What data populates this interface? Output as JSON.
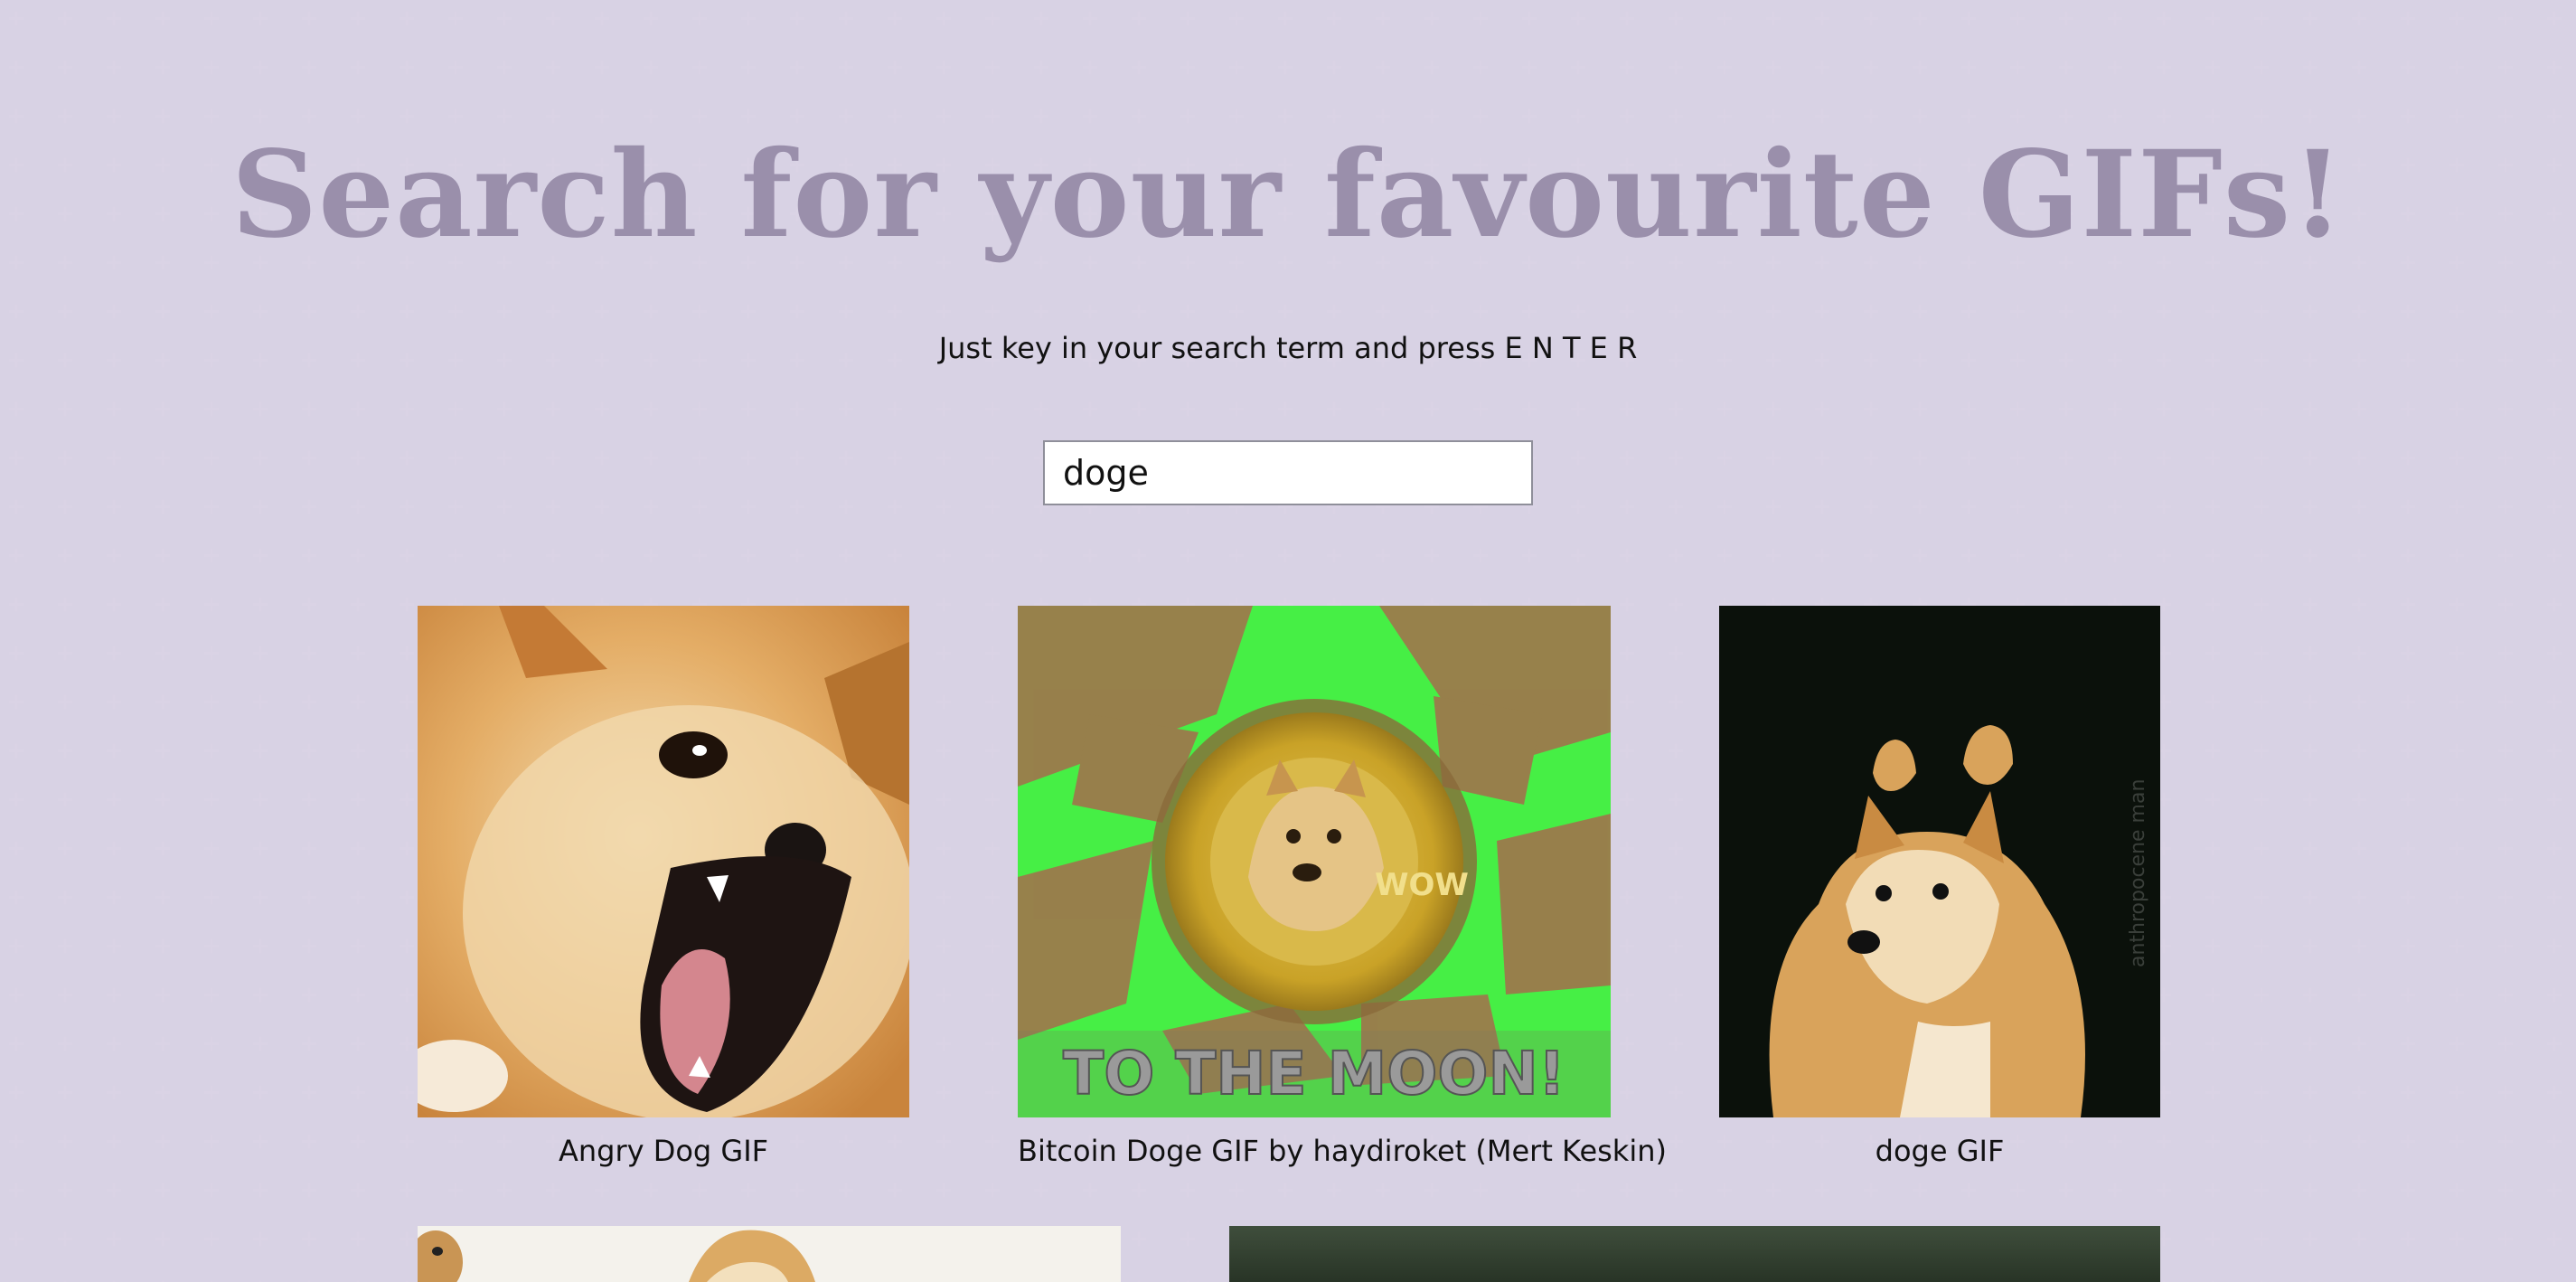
{
  "header": {
    "title": "Search for your favourite GIFs!",
    "subtitle": "Just key in your search term and press E N T E R"
  },
  "search": {
    "value": "doge",
    "placeholder": ""
  },
  "results": [
    {
      "caption": "Angry Dog GIF"
    },
    {
      "caption": "Bitcoin Doge GIF by haydiroket (Mert Keskin)"
    },
    {
      "caption": "doge GIF"
    },
    {
      "caption": ""
    },
    {
      "caption": ""
    }
  ],
  "image_texts": {
    "moon": "TO THE MOON!",
    "coin_wow": "WOW",
    "watermark": "anthropocene man"
  },
  "colors": {
    "background": "#f4f1f9",
    "pattern": "#dcd6e7",
    "title": "#9a8fab",
    "text": "#111111"
  }
}
